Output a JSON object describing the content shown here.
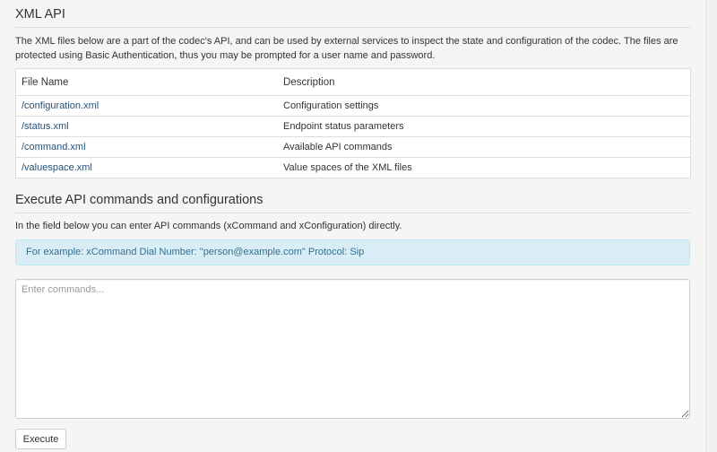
{
  "xml_api": {
    "title": "XML API",
    "intro": "The XML files below are a part of the codec's API, and can be used by external services to inspect the state and configuration of the codec. The files are protected using Basic Authentication, thus you may be prompted for a user name and password.",
    "table": {
      "headers": [
        "File Name",
        "Description"
      ],
      "rows": [
        {
          "file": "/configuration.xml",
          "description": "Configuration settings"
        },
        {
          "file": "/status.xml",
          "description": "Endpoint status parameters"
        },
        {
          "file": "/command.xml",
          "description": "Available API commands"
        },
        {
          "file": "/valuespace.xml",
          "description": "Value spaces of the XML files"
        }
      ]
    }
  },
  "execute": {
    "title": "Execute API commands and configurations",
    "intro": "In the field below you can enter API commands (xCommand and xConfiguration) directly.",
    "example": "For example: xCommand Dial Number: \"person@example.com\" Protocol: Sip",
    "placeholder": "Enter commands...",
    "button_label": "Execute"
  },
  "colors": {
    "background": "#f5f5f5",
    "link": "#23527c",
    "info_bg": "#d9edf7",
    "info_text": "#31708f"
  }
}
